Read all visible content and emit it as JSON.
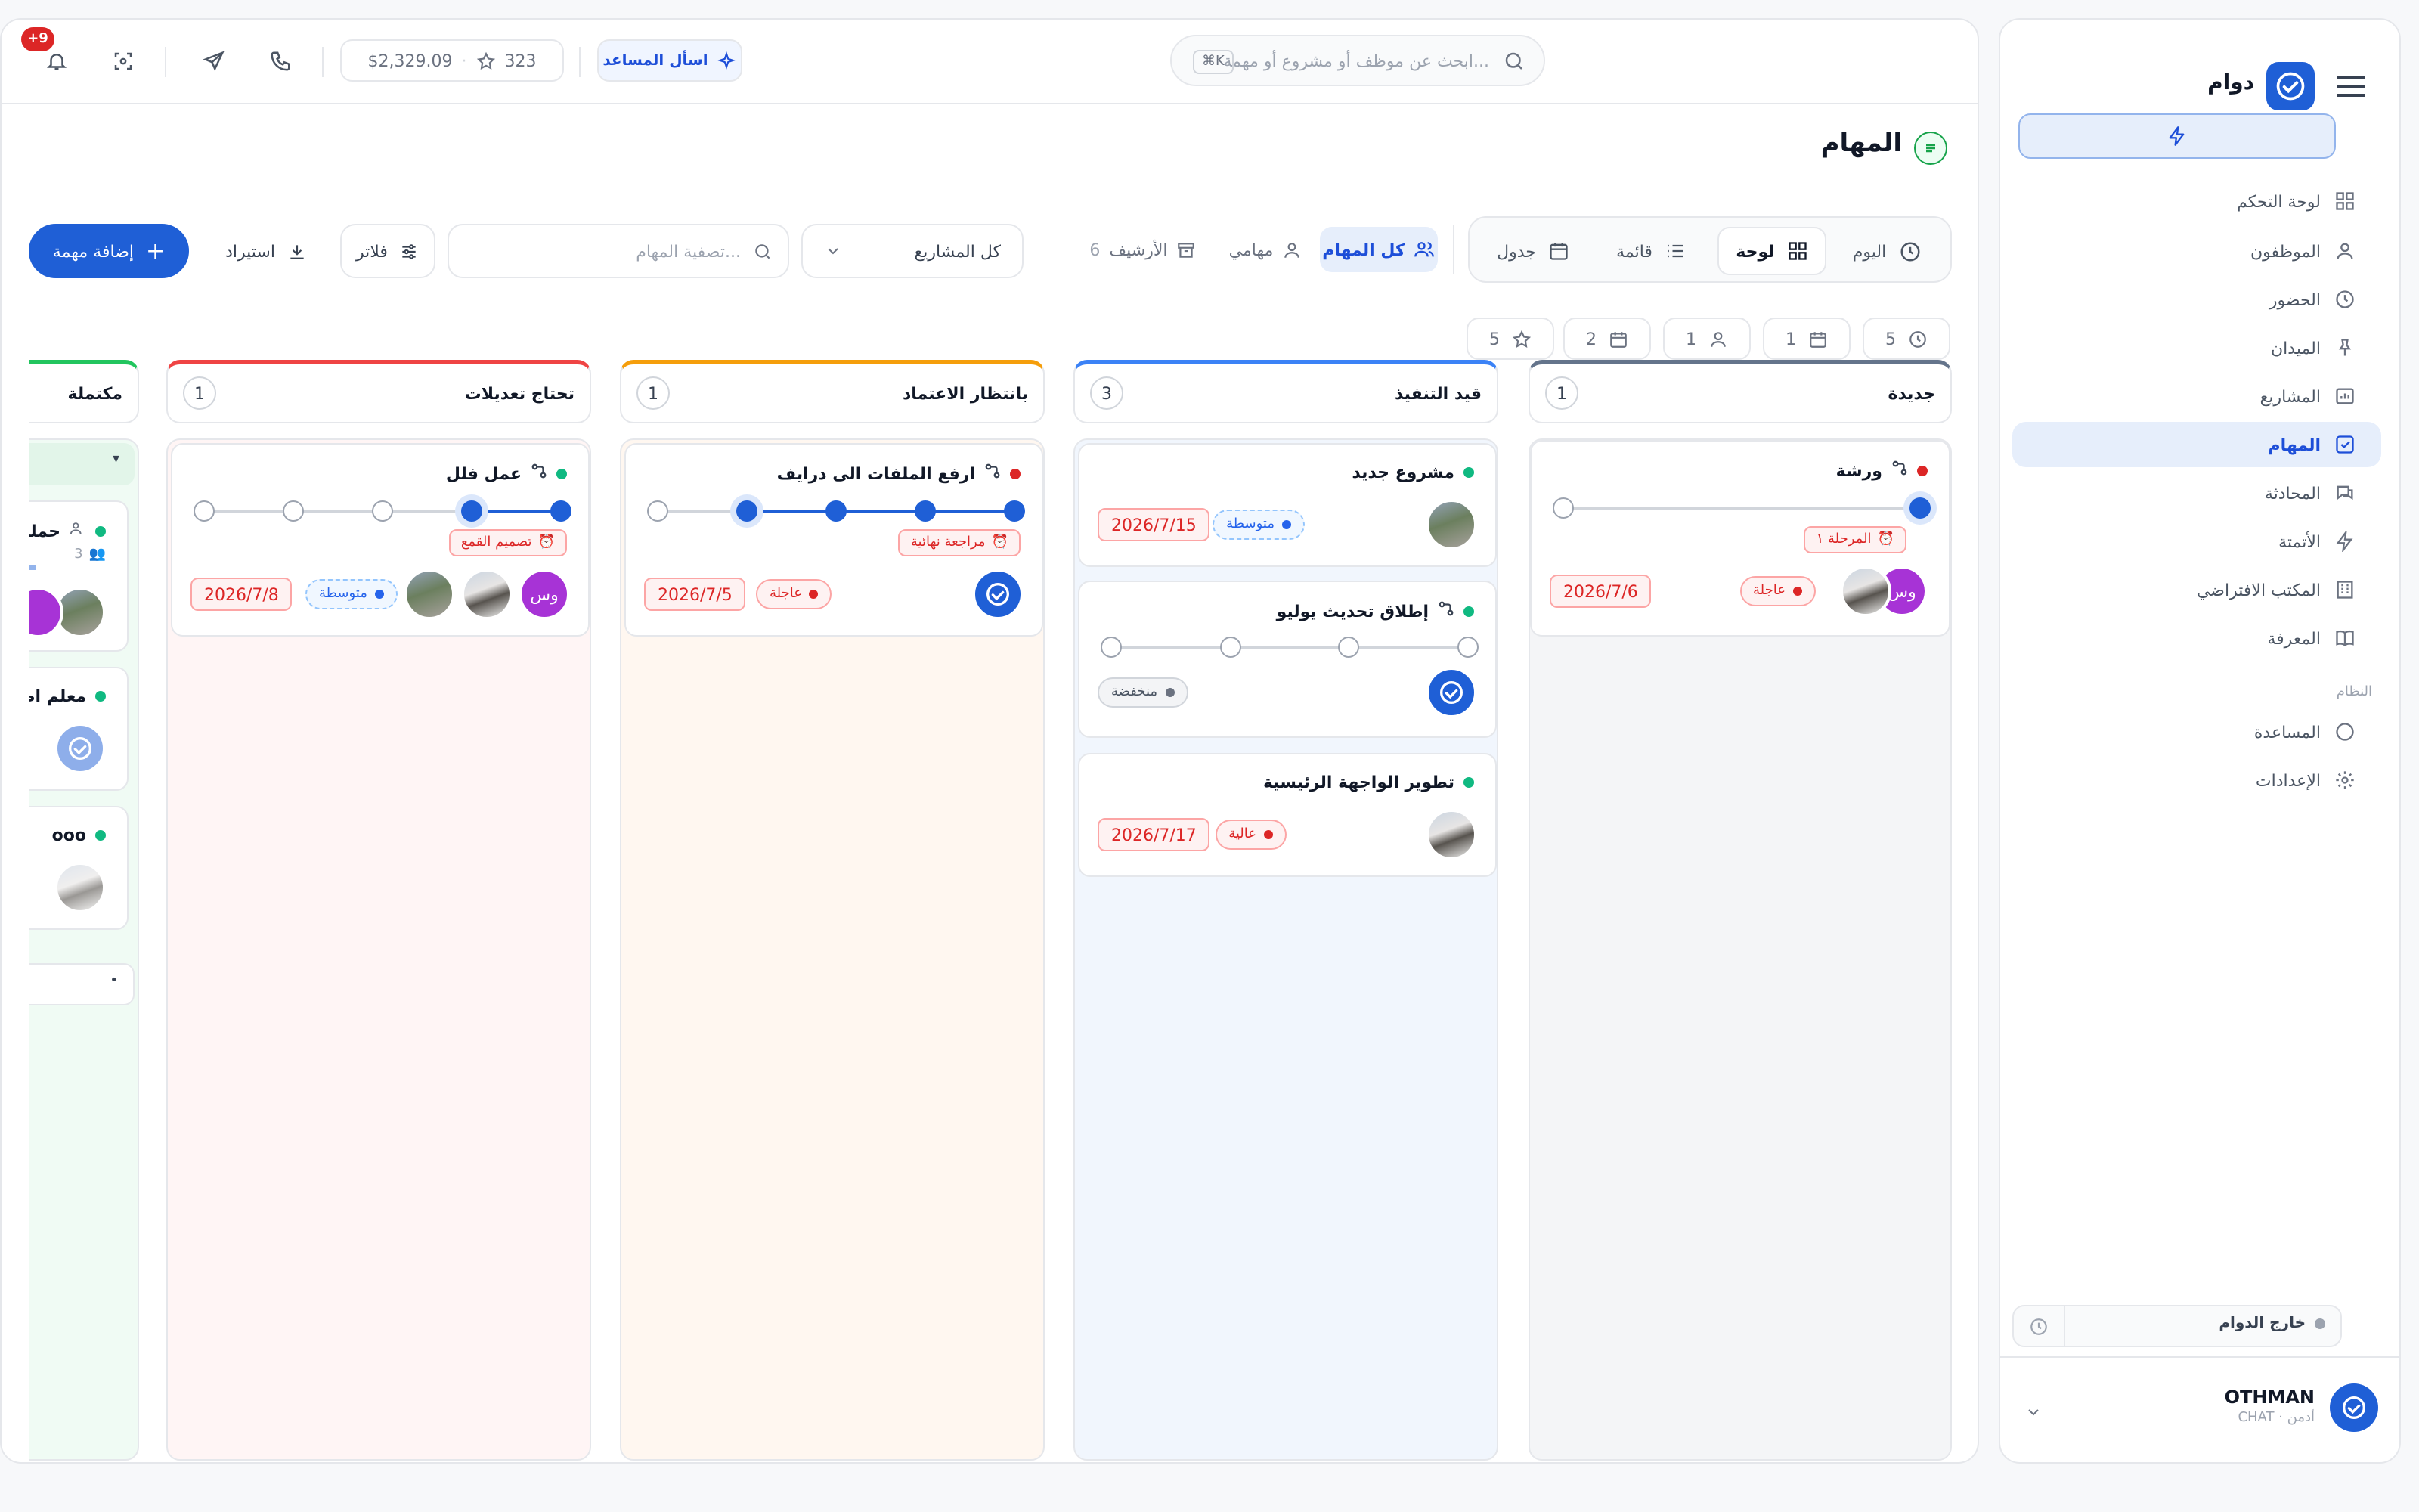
{
  "colors": {
    "accent": "#1f5fd6",
    "active_bg": "#e6eefb",
    "urgent": "#dc2626",
    "success": "#10b981",
    "avatar_purple": "#a733d6"
  },
  "sidebar": {
    "brand": "دوام",
    "items": [
      {
        "label": "لوحة التحكم",
        "icon": "dashboard-icon"
      },
      {
        "label": "الموظفون",
        "icon": "user-icon"
      },
      {
        "label": "الحضور",
        "icon": "clock-icon"
      },
      {
        "label": "الميدان",
        "icon": "pin-icon"
      },
      {
        "label": "المشاريع",
        "icon": "chart-icon"
      },
      {
        "label": "المهام",
        "icon": "checkbox-icon",
        "active": true
      },
      {
        "label": "المحادثة",
        "icon": "chat-icon"
      },
      {
        "label": "الأتمتة",
        "icon": "bolt-icon"
      },
      {
        "label": "المكتب الافتراضي",
        "icon": "building-icon"
      },
      {
        "label": "المعرفة",
        "icon": "book-icon"
      }
    ],
    "system_label": "النظام",
    "system_items": [
      {
        "label": "المساعدة",
        "icon": "help-icon"
      },
      {
        "label": "الإعدادات",
        "icon": "gear-icon"
      }
    ],
    "status": "خارج الدوام",
    "user": {
      "name": "OTHMAN",
      "sub": "CHAT · أدمن"
    }
  },
  "topbar": {
    "search_placeholder": "ابحث عن موظف أو مشروع أو مهمة...",
    "shortcut": "⌘K",
    "assistant": "اسأل المساعد",
    "balance": "$2,329.09",
    "points": "323",
    "notif_count": "+9"
  },
  "page": {
    "title": "المهام",
    "views": [
      "اليوم",
      "لوحة",
      "قائمة",
      "جدول"
    ],
    "filters": {
      "all": "كل المهام",
      "mine": "مهامي",
      "archive": "الأرشيف",
      "archive_count": "6"
    },
    "project_select": "كل المشاريع",
    "task_search_placeholder": "تصفية المهام...",
    "filters_btn": "فلاتر",
    "import_btn": "استيراد",
    "add_btn": "إضافة مهمة",
    "stats": [
      "5",
      "1",
      "1",
      "2",
      "5"
    ]
  },
  "columns": [
    {
      "title": "جديدة",
      "count": "1",
      "color": "#64748b",
      "bg": "#f4f5f7"
    },
    {
      "title": "قيد التنفيذ",
      "count": "3",
      "color": "#3b82f6",
      "bg": "#f1f6fd"
    },
    {
      "title": "بانتظار الاعتماد",
      "count": "1",
      "color": "#f59e0b",
      "bg": "#fff7f0"
    },
    {
      "title": "تحتاج تعديلات",
      "count": "1",
      "color": "#ef4444",
      "bg": "#fff5f5"
    },
    {
      "title": "مكتملة",
      "color": "#22c55e",
      "bg": "#f0fbf4"
    }
  ],
  "cards": {
    "c1": {
      "title": "ورشة",
      "stage": "المرحلة ١",
      "priority": "عاجلة",
      "date": "2026/7/6",
      "initials": "وس",
      "progress": 0.5
    },
    "c2": {
      "title": "مشروع جديد",
      "priority": "متوسطة",
      "date": "2026/7/15"
    },
    "c3": {
      "title": "إطلاق تحديث يوليو",
      "priority": "منخفضة",
      "progress": 0
    },
    "c4": {
      "title": "تطوير الواجهة الرئيسية",
      "priority": "عالية",
      "date": "2026/7/17"
    },
    "c5": {
      "title": "ارفع الملفات الى درايف",
      "stage": "مراجعة نهائية",
      "priority": "عاجلة",
      "date": "2026/7/5",
      "progress": 0.75
    },
    "c6": {
      "title": "عمل فلل",
      "stage": "تصميم القمع",
      "priority": "متوسطة",
      "date": "2026/7/8",
      "initials": "وس",
      "progress": 0.25
    },
    "d1": {
      "title": "حملة",
      "members": "3"
    },
    "d2": {
      "title": "معلم اطلا"
    },
    "d3": {
      "title": "ooo"
    }
  }
}
